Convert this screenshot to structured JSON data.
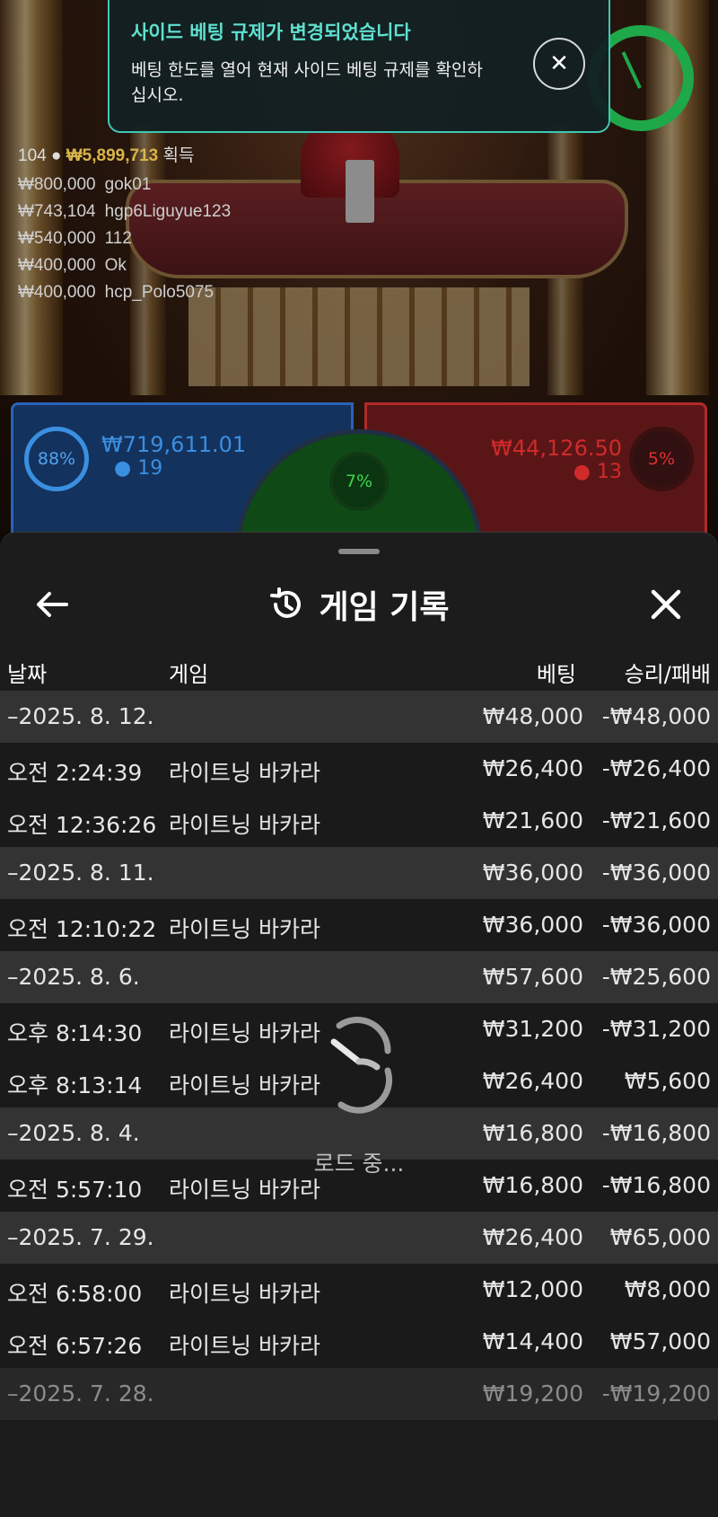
{
  "notification": {
    "title": "사이드 베팅 규제가 변경되었습니다",
    "body": "베팅 한도를 열어 현재 사이드 베팅 규제를 확인하십시오."
  },
  "winners": {
    "count": "104",
    "total": "₩5,899,713",
    "suffix": "획득",
    "list": [
      {
        "amount": "₩800,000",
        "name": "gok01"
      },
      {
        "amount": "₩743,104",
        "name": "hgp6Liguyue123"
      },
      {
        "amount": "₩540,000",
        "name": "112"
      },
      {
        "amount": "₩400,000",
        "name": "Ok"
      },
      {
        "amount": "₩400,000",
        "name": "hcp_Polo5075"
      }
    ]
  },
  "bets": {
    "player": {
      "pct": "88%",
      "amount": "₩719,611.01",
      "players": "19"
    },
    "tie": {
      "pct": "7%"
    },
    "banker": {
      "pct": "5%",
      "amount": "₩44,126.50",
      "players": "13"
    }
  },
  "history": {
    "title": "게임 기록",
    "columns": {
      "date": "날짜",
      "game": "게임",
      "bet": "베팅",
      "result": "승리/패배"
    },
    "loading": "로드 중...",
    "rows": [
      {
        "type": "date",
        "time": "–2025. 8. 12.",
        "game": "",
        "bet": "₩48,000",
        "result": "-₩48,000"
      },
      {
        "type": "game",
        "time": "오전 2:24:39",
        "game": "라이트닝 바카라",
        "bet": "₩26,400",
        "result": "-₩26,400"
      },
      {
        "type": "game",
        "time": "오전 12:36:26",
        "game": "라이트닝 바카라",
        "bet": "₩21,600",
        "result": "-₩21,600"
      },
      {
        "type": "date",
        "time": "–2025. 8. 11.",
        "game": "",
        "bet": "₩36,000",
        "result": "-₩36,000"
      },
      {
        "type": "game",
        "time": "오전 12:10:22",
        "game": "라이트닝 바카라",
        "bet": "₩36,000",
        "result": "-₩36,000"
      },
      {
        "type": "date",
        "time": "–2025. 8. 6.",
        "game": "",
        "bet": "₩57,600",
        "result": "-₩25,600"
      },
      {
        "type": "game",
        "time": "오후 8:14:30",
        "game": "라이트닝 바카라",
        "bet": "₩31,200",
        "result": "-₩31,200"
      },
      {
        "type": "game",
        "time": "오후 8:13:14",
        "game": "라이트닝 바카라",
        "bet": "₩26,400",
        "result": "₩5,600"
      },
      {
        "type": "date",
        "time": "–2025. 8. 4.",
        "game": "",
        "bet": "₩16,800",
        "result": "-₩16,800"
      },
      {
        "type": "game",
        "time": "오전 5:57:10",
        "game": "라이트닝 바카라",
        "bet": "₩16,800",
        "result": "-₩16,800"
      },
      {
        "type": "date",
        "time": "–2025. 7. 29.",
        "game": "",
        "bet": "₩26,400",
        "result": "₩65,000"
      },
      {
        "type": "game",
        "time": "오전 6:58:00",
        "game": "라이트닝 바카라",
        "bet": "₩12,000",
        "result": "₩8,000"
      },
      {
        "type": "game",
        "time": "오전 6:57:26",
        "game": "라이트닝 바카라",
        "bet": "₩14,400",
        "result": "₩57,000"
      },
      {
        "type": "date",
        "time": "–2025. 7. 28.",
        "game": "",
        "bet": "₩19,200",
        "result": "-₩19,200"
      }
    ]
  }
}
